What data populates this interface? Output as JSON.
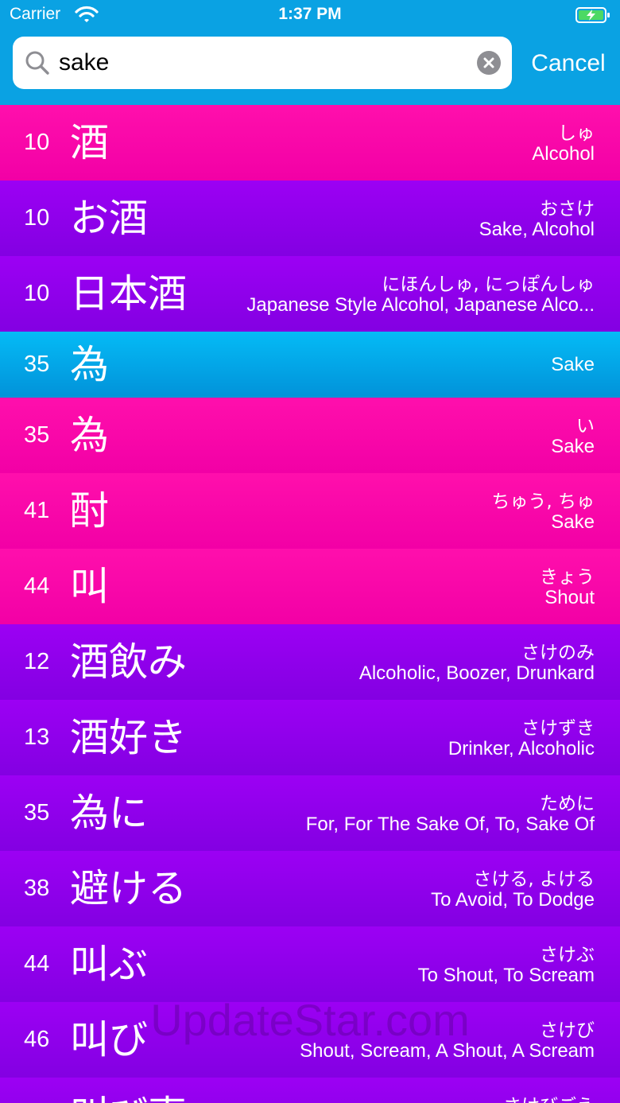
{
  "status_bar": {
    "carrier": "Carrier",
    "time": "1:37 PM"
  },
  "search": {
    "value": "sake",
    "cancel_label": "Cancel"
  },
  "results": [
    {
      "level": "10",
      "word": "酒",
      "reading": "しゅ",
      "meaning": "Alcohol",
      "color": "pink"
    },
    {
      "level": "10",
      "word": "お酒",
      "reading": "おさけ",
      "meaning": "Sake, Alcohol",
      "color": "purple"
    },
    {
      "level": "10",
      "word": "日本酒",
      "reading": "にほんしゅ, にっぽんしゅ",
      "meaning": "Japanese Style Alcohol, Japanese Alco...",
      "color": "purple"
    },
    {
      "level": "35",
      "word": "為",
      "reading": "",
      "meaning": "Sake",
      "color": "blue"
    },
    {
      "level": "35",
      "word": "為",
      "reading": "い",
      "meaning": "Sake",
      "color": "pink"
    },
    {
      "level": "41",
      "word": "酎",
      "reading": "ちゅう, ちゅ",
      "meaning": "Sake",
      "color": "pink"
    },
    {
      "level": "44",
      "word": "叫",
      "reading": "きょう",
      "meaning": "Shout",
      "color": "pink"
    },
    {
      "level": "12",
      "word": "酒飲み",
      "reading": "さけのみ",
      "meaning": "Alcoholic, Boozer, Drunkard",
      "color": "purple"
    },
    {
      "level": "13",
      "word": "酒好き",
      "reading": "さけずき",
      "meaning": "Drinker, Alcoholic",
      "color": "purple"
    },
    {
      "level": "35",
      "word": "為に",
      "reading": "ために",
      "meaning": "For, For The Sake Of, To, Sake Of",
      "color": "purple"
    },
    {
      "level": "38",
      "word": "避ける",
      "reading": "さける, よける",
      "meaning": "To Avoid, To Dodge",
      "color": "purple"
    },
    {
      "level": "44",
      "word": "叫ぶ",
      "reading": "さけぶ",
      "meaning": "To Shout, To Scream",
      "color": "purple"
    },
    {
      "level": "46",
      "word": "叫び",
      "reading": "さけび",
      "meaning": "Shout, Scream, A Shout, A Scream",
      "color": "purple"
    },
    {
      "level": "",
      "word": "叫び声",
      "reading": "さけびごえ",
      "meaning": "",
      "color": "purple"
    }
  ],
  "watermark": "UpdateStar.com",
  "colors": {
    "header": "#0aa2e3",
    "pink": "#ff0fac",
    "purple": "#9000ea",
    "blue": "#05bbf6"
  }
}
